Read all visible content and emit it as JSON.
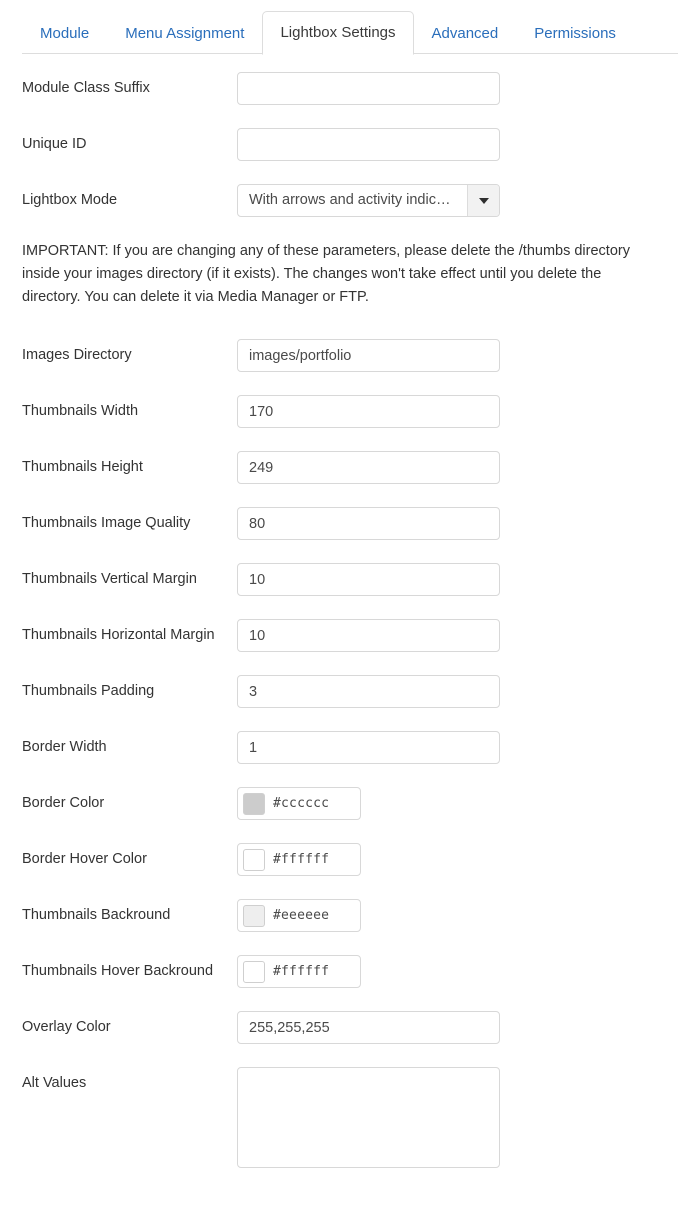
{
  "tabs": [
    {
      "label": "Module",
      "active": false
    },
    {
      "label": "Menu Assignment",
      "active": false
    },
    {
      "label": "Lightbox Settings",
      "active": true
    },
    {
      "label": "Advanced",
      "active": false
    },
    {
      "label": "Permissions",
      "active": false
    }
  ],
  "colors": {
    "tab_link": "#2a6ebb",
    "tab_active_text": "#3a3a3a",
    "border": "#dddddd",
    "input_border": "#d8d8d8",
    "text": "#333333"
  },
  "notice": {
    "text": "IMPORTANT: If you are changing any of these parameters, please delete the /thumbs directory inside your images directory (if it exists). The changes won't take effect until you delete the directory. You can delete it via Media Manager or FTP."
  },
  "fields": {
    "module_class_suffix": {
      "label": "Module Class Suffix",
      "value": "",
      "placeholder": "",
      "type": "text"
    },
    "unique_id": {
      "label": "Unique ID",
      "value": "",
      "placeholder": "",
      "type": "text"
    },
    "lightbox_mode": {
      "label": "Lightbox Mode",
      "value": "With arrows and activity indic…",
      "type": "select",
      "caret_icon": "chevron-down-icon"
    },
    "images_directory": {
      "label": "Images Directory",
      "value": "images/portfolio",
      "type": "text"
    },
    "thumbnails_width": {
      "label": "Thumbnails Width",
      "value": "170",
      "type": "text"
    },
    "thumbnails_height": {
      "label": "Thumbnails Height",
      "value": "249",
      "type": "text"
    },
    "thumbnails_image_quality": {
      "label": "Thumbnails Image Quality",
      "value": "80",
      "type": "text"
    },
    "thumbnails_vertical_margin": {
      "label": "Thumbnails Vertical Margin",
      "value": "10",
      "type": "text"
    },
    "thumbnails_horizontal_margin": {
      "label": "Thumbnails Horizontal Margin",
      "value": "10",
      "type": "text"
    },
    "thumbnails_padding": {
      "label": "Thumbnails Padding",
      "value": "3",
      "type": "text"
    },
    "border_width": {
      "label": "Border Width",
      "value": "1",
      "type": "text"
    },
    "border_color": {
      "label": "Border Color",
      "value": "#cccccc",
      "swatch": "#cccccc",
      "type": "color"
    },
    "border_hover_color": {
      "label": "Border Hover Color",
      "value": "#ffffff",
      "swatch": "#ffffff",
      "type": "color"
    },
    "thumbnails_backround": {
      "label": "Thumbnails Backround",
      "value": "#eeeeee",
      "swatch": "#eeeeee",
      "type": "color"
    },
    "thumbnails_hover_backround": {
      "label": "Thumbnails Hover Backround",
      "value": "#ffffff",
      "swatch": "#ffffff",
      "type": "color"
    },
    "overlay_color": {
      "label": "Overlay Color",
      "value": "255,255,255",
      "type": "text"
    },
    "alt_values": {
      "label": "Alt Values",
      "value": "",
      "type": "textarea"
    }
  }
}
